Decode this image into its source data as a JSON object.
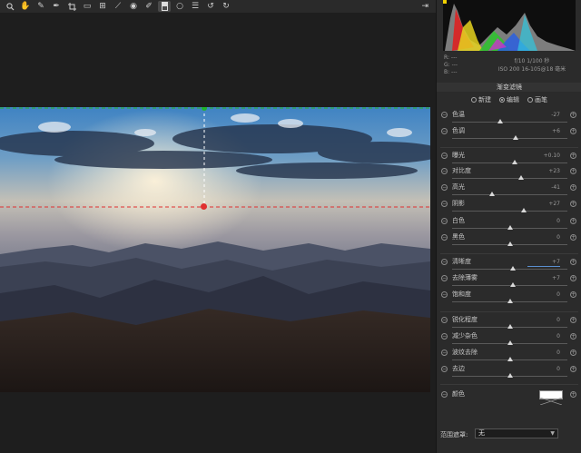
{
  "toolbar": {
    "tools": [
      "zoom-icon",
      "hand-icon",
      "white-balance-icon",
      "color-sampler-icon",
      "crop-icon",
      "straighten-icon",
      "transform-icon",
      "spot-removal-icon",
      "red-eye-icon",
      "adjustment-brush-icon",
      "graduated-filter-icon",
      "radial-filter-icon",
      "list-icon",
      "rotate-ccw-icon",
      "rotate-cw-icon"
    ],
    "active_tool": "graduated-filter-icon"
  },
  "info": {
    "rgb": [
      "R: ---",
      "G: ---",
      "B: ---"
    ],
    "camera_line1": "f/10  1/100 秒",
    "camera_line2": "ISO 200  16-105@18 毫米"
  },
  "panel": {
    "title": "渐变滤镜",
    "modes": [
      {
        "label": "新建",
        "selected": false
      },
      {
        "label": "编辑",
        "selected": true
      },
      {
        "label": "画笔",
        "selected": false
      }
    ],
    "sliders": [
      {
        "label": "色温",
        "value": "-27",
        "pos": 0.42
      },
      {
        "label": "色调",
        "value": "+6",
        "pos": 0.55
      },
      {
        "label": "曝光",
        "value": "+0.10",
        "pos": 0.54
      },
      {
        "label": "对比度",
        "value": "+23",
        "pos": 0.6
      },
      {
        "label": "高光",
        "value": "-41",
        "pos": 0.35
      },
      {
        "label": "阴影",
        "value": "+27",
        "pos": 0.62
      },
      {
        "label": "白色",
        "value": "0",
        "pos": 0.5
      },
      {
        "label": "黑色",
        "value": "0",
        "pos": 0.5
      },
      {
        "label": "清晰度",
        "value": "+7",
        "pos": 0.53
      },
      {
        "label": "去除薄雾",
        "value": "+7",
        "pos": 0.53
      },
      {
        "label": "饱和度",
        "value": "0",
        "pos": 0.5
      },
      {
        "label": "锐化程度",
        "value": "0",
        "pos": 0.5
      },
      {
        "label": "减少杂色",
        "value": "0",
        "pos": 0.5
      },
      {
        "label": "波纹去除",
        "value": "0",
        "pos": 0.5
      },
      {
        "label": "去边",
        "value": "0",
        "pos": 0.5
      }
    ],
    "color_label": "颜色",
    "mask_label": "范围遮罩:",
    "mask_value": "无"
  },
  "colors": {
    "guide_green": "#1fb32a",
    "guide_red": "#e03030",
    "panel_bg": "#2b2b2b"
  }
}
